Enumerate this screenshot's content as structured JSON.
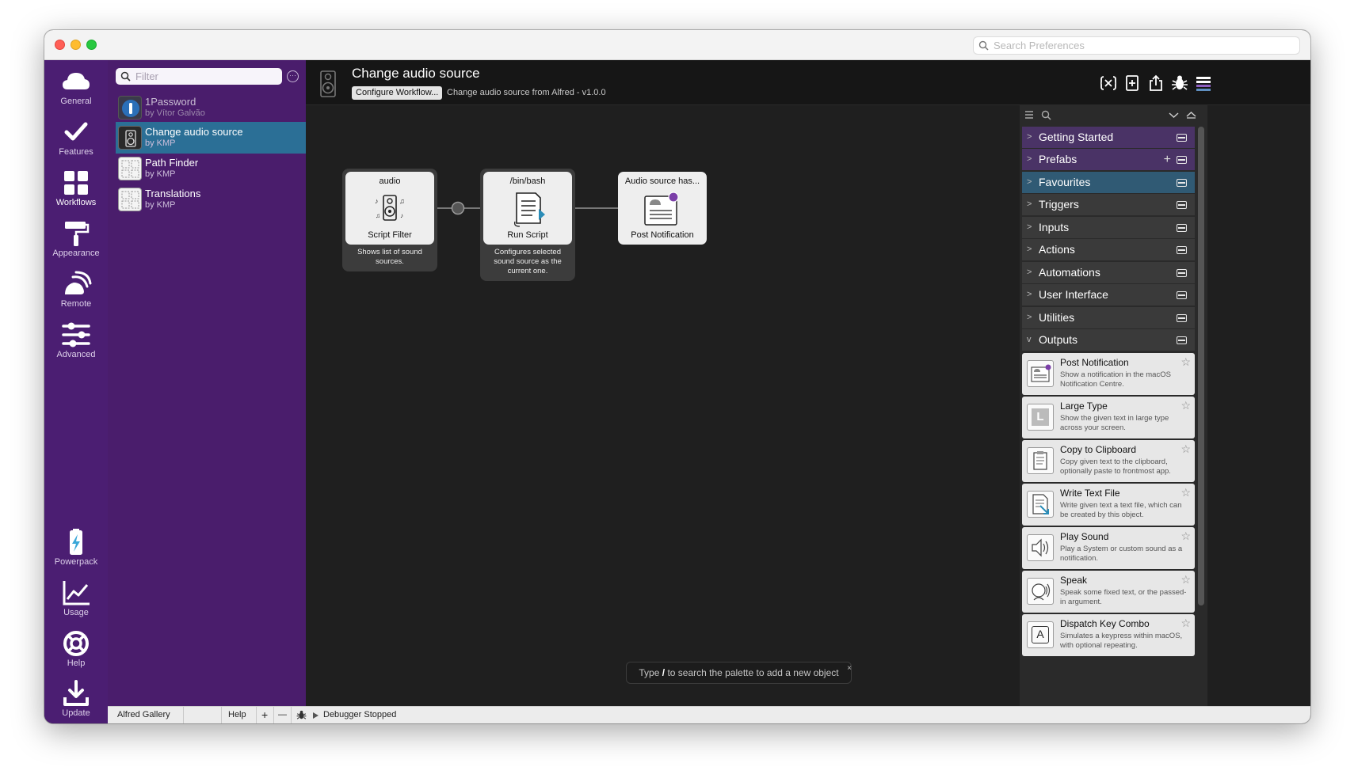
{
  "prefs_search": {
    "placeholder": "Search Preferences"
  },
  "nav": {
    "top": [
      {
        "label": "General",
        "icon": "cloud-icon"
      },
      {
        "label": "Features",
        "icon": "checkmark-icon"
      },
      {
        "label": "Workflows",
        "icon": "grid-icon"
      },
      {
        "label": "Appearance",
        "icon": "paint-roller-icon"
      },
      {
        "label": "Remote",
        "icon": "remote-icon"
      },
      {
        "label": "Advanced",
        "icon": "sliders-icon"
      }
    ],
    "bottom": [
      {
        "label": "Powerpack",
        "icon": "battery-icon"
      },
      {
        "label": "Usage",
        "icon": "chart-icon"
      },
      {
        "label": "Help",
        "icon": "lifebuoy-icon"
      },
      {
        "label": "Update",
        "icon": "download-icon"
      }
    ]
  },
  "workflows": {
    "filter_placeholder": "Filter",
    "items": [
      {
        "name": "1Password",
        "by": "by Vítor Galvão"
      },
      {
        "name": "Change audio source",
        "by": "by KMP"
      },
      {
        "name": "Path Finder",
        "by": "by KMP"
      },
      {
        "name": "Translations",
        "by": "by KMP"
      }
    ]
  },
  "bottombar": {
    "gallery": "Alfred Gallery",
    "help": "Help",
    "add": "+",
    "remove": "—",
    "debugger": "Debugger Stopped"
  },
  "editor": {
    "title": "Change audio source",
    "configure": "Configure Workflow...",
    "subtitle": "Change audio source from Alfred - v1.0.0",
    "hint_prefix": "Type",
    "hint_key": "/",
    "hint_suffix": "to search the palette to add a new object",
    "hint_close": "×"
  },
  "nodes": [
    {
      "top": "audio",
      "bottom": "Script Filter",
      "desc": [
        "Shows list of sound",
        "sources."
      ]
    },
    {
      "top": "/bin/bash",
      "bottom": "Run Script",
      "desc": [
        "Configures selected",
        "sound source as the",
        "current one."
      ]
    },
    {
      "top": "Audio source has...",
      "bottom": "Post Notification"
    }
  ],
  "palette": {
    "categories": [
      "Getting Started",
      "Prefabs",
      "Favourites",
      "Triggers",
      "Inputs",
      "Actions",
      "Automations",
      "User Interface",
      "Utilities",
      "Outputs"
    ],
    "outputs": [
      {
        "title": "Post Notification",
        "desc": "Show a notification in the macOS Notification Centre."
      },
      {
        "title": "Large Type",
        "desc": "Show the given text in large type across your screen."
      },
      {
        "title": "Copy to Clipboard",
        "desc": "Copy given text to the clipboard, optionally paste to frontmost app."
      },
      {
        "title": "Write Text File",
        "desc": "Write given text a text file, which can be created by this object."
      },
      {
        "title": "Play Sound",
        "desc": "Play a System or custom sound as a notification."
      },
      {
        "title": "Speak",
        "desc": "Speak some fixed text, or the passed-in argument."
      },
      {
        "title": "Dispatch Key Combo",
        "desc": "Simulates a keypress within macOS, with optional repeating."
      }
    ],
    "large_type_letter": "L",
    "key_combo_letter": "A"
  },
  "colors": {
    "nav_bg": "#4b1e72",
    "selected_row": "#2b6f96",
    "notification_dot": "#7b3fa8"
  }
}
